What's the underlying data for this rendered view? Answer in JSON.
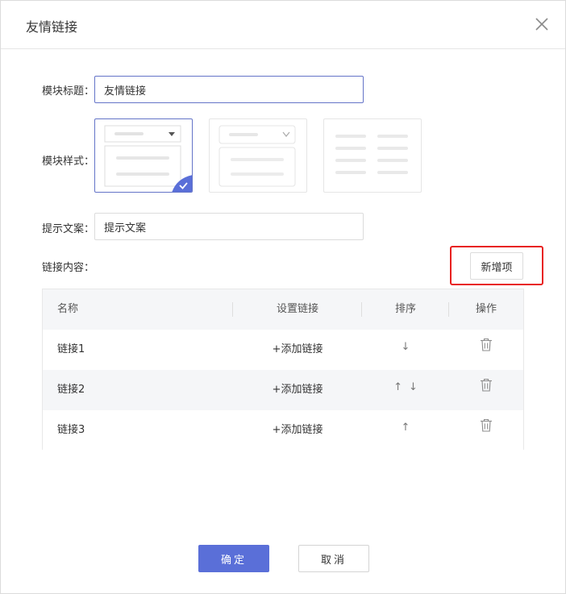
{
  "dialog": {
    "title": "友情链接",
    "close_icon": "close-icon"
  },
  "form": {
    "module_title_label": "模块标题：",
    "module_title_value": "友情链接",
    "module_style_label": "模块样式：",
    "styles": [
      {
        "name": "dropdown-list",
        "selected": true
      },
      {
        "name": "select-list",
        "selected": false
      },
      {
        "name": "two-column-text",
        "selected": false
      }
    ],
    "hint_label": "提示文案：",
    "hint_value": "提示文案",
    "link_content_label": "链接内容：",
    "add_item_button": "新增项"
  },
  "table": {
    "headers": {
      "name": "名称",
      "link": "设置链接",
      "sort": "排序",
      "op": "操作"
    },
    "rows": [
      {
        "name": "链接1",
        "link": "+添加链接",
        "sort_up": false,
        "sort_down": true
      },
      {
        "name": "链接2",
        "link": "+添加链接",
        "sort_up": true,
        "sort_down": true
      },
      {
        "name": "链接3",
        "link": "+添加链接",
        "sort_up": true,
        "sort_down": false
      }
    ],
    "up_arrow": "↑",
    "down_arrow": "↓",
    "delete_icon": "trash-icon"
  },
  "footer": {
    "ok_label": "确定",
    "cancel_label": "取消"
  },
  "colors": {
    "primary": "#5a6fd8",
    "selected_border": "#6474c8",
    "highlight": "#e8201f"
  }
}
